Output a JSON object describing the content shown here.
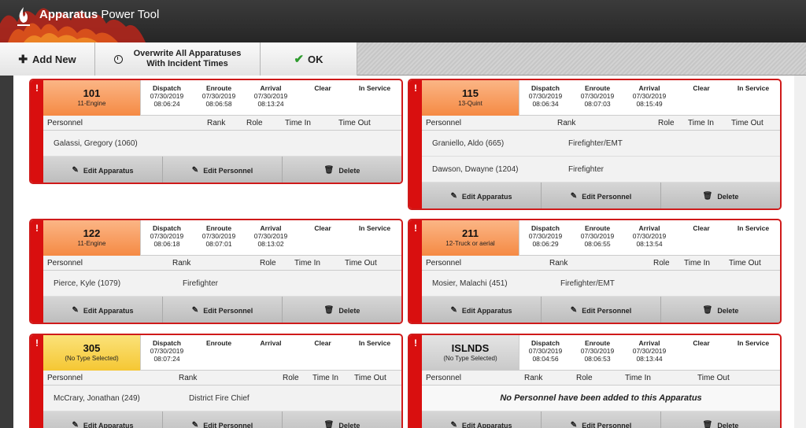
{
  "app": {
    "title_bold": "Apparatus",
    "title_rest": " Power Tool"
  },
  "toolbar": {
    "add_label": "Add New",
    "overwrite_line1": "Overwrite All Apparatuses",
    "overwrite_line2": "With Incident Times",
    "ok_label": "OK"
  },
  "columns": {
    "dispatch": "Dispatch",
    "enroute": "Enroute",
    "arrival": "Arrival",
    "clear": "Clear",
    "in_service": "In Service",
    "personnel": "Personnel",
    "rank": "Rank",
    "role": "Role",
    "time_in": "Time In",
    "time_out": "Time Out"
  },
  "actions": {
    "edit_apparatus": "Edit Apparatus",
    "edit_personnel": "Edit Personnel",
    "delete": "Delete"
  },
  "alert_mark": "!",
  "cards": [
    {
      "name": "101",
      "type": "11-Engine",
      "color": "orange",
      "dispatch_date": "07/30/2019",
      "dispatch_time": "08:06:24",
      "enroute_date": "07/30/2019",
      "enroute_time": "08:06:58",
      "arrival_date": "07/30/2019",
      "arrival_time": "08:13:24",
      "personnel": [
        {
          "name": "Galassi, Gregory (1060)",
          "rank": ""
        }
      ]
    },
    {
      "name": "115",
      "type": "13-Quint",
      "color": "orange",
      "dispatch_date": "07/30/2019",
      "dispatch_time": "08:06:34",
      "enroute_date": "07/30/2019",
      "enroute_time": "08:07:03",
      "arrival_date": "07/30/2019",
      "arrival_time": "08:15:49",
      "personnel": [
        {
          "name": "Graniello, Aldo (665)",
          "rank": "Firefighter/EMT"
        },
        {
          "name": "Dawson, Dwayne (1204)",
          "rank": "Firefighter"
        }
      ]
    },
    {
      "name": "122",
      "type": "11-Engine",
      "color": "orange",
      "dispatch_date": "07/30/2019",
      "dispatch_time": "08:06:18",
      "enroute_date": "07/30/2019",
      "enroute_time": "08:07:01",
      "arrival_date": "07/30/2019",
      "arrival_time": "08:13:02",
      "personnel": [
        {
          "name": "Pierce, Kyle (1079)",
          "rank": "Firefighter"
        }
      ]
    },
    {
      "name": "211",
      "type": "12-Truck or aerial",
      "color": "orange",
      "dispatch_date": "07/30/2019",
      "dispatch_time": "08:06:29",
      "enroute_date": "07/30/2019",
      "enroute_time": "08:06:55",
      "arrival_date": "07/30/2019",
      "arrival_time": "08:13:54",
      "personnel": [
        {
          "name": "Mosier, Malachi (451)",
          "rank": "Firefighter/EMT"
        }
      ]
    },
    {
      "name": "305",
      "type": "(No Type Selected)",
      "color": "yellow",
      "dispatch_date": "07/30/2019",
      "dispatch_time": "08:07:24",
      "enroute_date": "",
      "enroute_time": "",
      "arrival_date": "",
      "arrival_time": "",
      "personnel": [
        {
          "name": "McCrary, Jonathan (249)",
          "rank": "District Fire Chief"
        }
      ]
    },
    {
      "name": "ISLNDS",
      "type": "(No Type Selected)",
      "color": "gray",
      "dispatch_date": "07/30/2019",
      "dispatch_time": "08:04:56",
      "enroute_date": "07/30/2019",
      "enroute_time": "08:06:53",
      "arrival_date": "07/30/2019",
      "arrival_time": "08:13:44",
      "personnel": [],
      "empty_message": "No Personnel have been added to this Apparatus"
    }
  ]
}
